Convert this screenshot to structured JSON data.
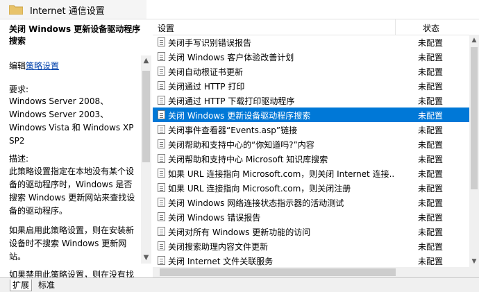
{
  "header": {
    "title": "Internet 通信设置"
  },
  "left_pane": {
    "policy_title": "关闭 Windows 更新设备驱动程序搜索",
    "edit_prefix": "编辑",
    "edit_link": "策略设置",
    "req_label": "要求:",
    "req_lines": [
      "Windows Server 2008、",
      "Windows Server 2003、",
      "Windows Vista 和 Windows XP",
      "SP2"
    ],
    "desc_label": "描述:",
    "desc_lines": [
      "此策略设置指定在本地没有某个设",
      "备的驱动程序时，Windows 是否",
      "搜索 Windows 更新网站来查找设",
      "备的驱动程序。"
    ],
    "desc2_lines": [
      "如果启用此策略设置，则在安装新",
      "设备时不搜索 Windows 更新网",
      "站。"
    ],
    "desc3_line": "如果禁用此策略设置，则在没有找"
  },
  "list": {
    "col_setting": "设置",
    "col_state": "状态",
    "rows": [
      {
        "name": "关闭手写识别错误报告",
        "state": "未配置"
      },
      {
        "name": "关闭 Windows 客户体验改善计划",
        "state": "未配置"
      },
      {
        "name": "关闭自动根证书更新",
        "state": "未配置"
      },
      {
        "name": "关闭通过 HTTP 打印",
        "state": "未配置"
      },
      {
        "name": "关闭通过 HTTP 下载打印驱动程序",
        "state": "未配置"
      },
      {
        "name": "关闭 Windows 更新设备驱动程序搜索",
        "state": "未配置"
      },
      {
        "name": "关闭事件查看器“Events.asp”链接",
        "state": "未配置"
      },
      {
        "name": "关闭帮助和支持中心的“你知道吗?”内容",
        "state": "未配置"
      },
      {
        "name": "关闭帮助和支持中心 Microsoft 知识库搜索",
        "state": "未配置"
      },
      {
        "name": "如果 URL 连接指向 Microsoft.com，则关闭 Internet 连接...",
        "state": "未配置"
      },
      {
        "name": "如果 URL 连接指向 Microsoft.com，则关闭注册",
        "state": "未配置"
      },
      {
        "name": "关闭 Windows 网络连接状态指示器的活动测试",
        "state": "未配置"
      },
      {
        "name": "关闭 Windows 错误报告",
        "state": "未配置"
      },
      {
        "name": "关闭对所有 Windows 更新功能的访问",
        "state": "未配置"
      },
      {
        "name": "关闭搜索助理内容文件更新",
        "state": "未配置"
      },
      {
        "name": "关闭 Internet 文件关联服务",
        "state": "未配置"
      }
    ],
    "selected_index": 5
  },
  "tabs": {
    "extended": "扩展",
    "standard": "标准"
  },
  "colors": {
    "selection": "#0078d7",
    "link": "#0645ad"
  }
}
